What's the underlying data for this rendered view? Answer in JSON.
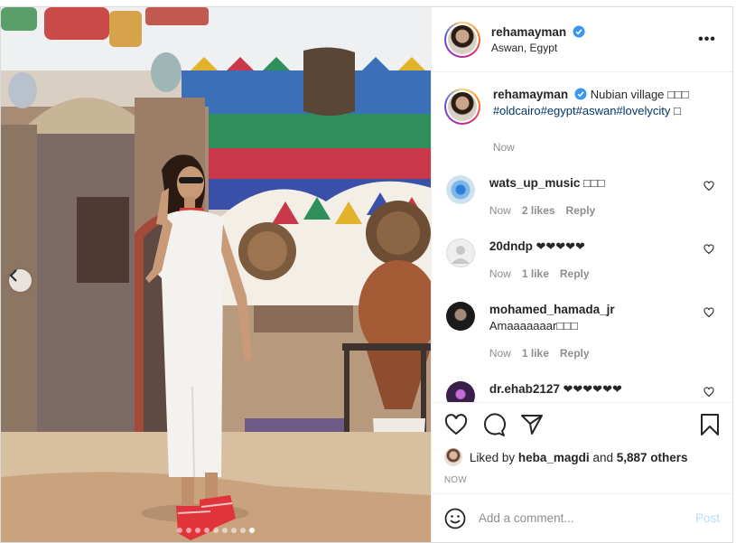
{
  "post": {
    "author": {
      "username": "rehamayman",
      "verified": true,
      "location": "Aswan, Egypt"
    },
    "more_icon": "more-options-icon",
    "caption": {
      "text": "Nubian village □□□",
      "hashtags": "#oldcairo#egypt#aswan#lovelycity",
      "trailing": "□",
      "time": "Now"
    },
    "comments": [
      {
        "username": "wats_up_music",
        "text": "□□□",
        "time": "Now",
        "likes": "2 likes",
        "reply": "Reply",
        "avatar_color": "#cfe3ee"
      },
      {
        "username": "20dndp",
        "text": "❤❤❤❤❤",
        "time": "Now",
        "likes": "1 like",
        "reply": "Reply",
        "avatar_color": "#dbdbdb"
      },
      {
        "username": "mohamed_hamada_jr",
        "text": "Amaaaaaaar□□□",
        "time": "Now",
        "likes": "1 like",
        "reply": "Reply",
        "avatar_color": "#1b1b1b"
      },
      {
        "username": "dr.ehab2127",
        "text": "❤❤❤❤❤❤",
        "avatar_color": "#3a1f4a"
      }
    ],
    "liked_by": {
      "prefix": "Liked by",
      "user": "heba_magdi",
      "conjunction": "and",
      "others": "5,887 others"
    },
    "posted_time": "NOW",
    "add_comment": {
      "placeholder": "Add a comment...",
      "post_label": "Post"
    },
    "carousel": {
      "slide_count": 9,
      "active_index": 8
    },
    "colors": {
      "link": "#00376b",
      "secondary": "#8e8e8e",
      "post_button_disabled": "#b2dffc",
      "verified": "#3897f0"
    }
  }
}
